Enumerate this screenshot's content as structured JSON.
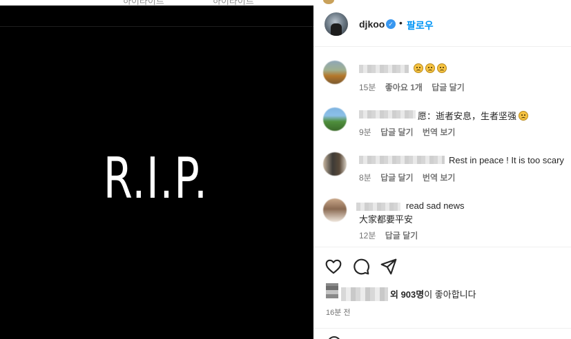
{
  "background": {
    "tab_labels": [
      "하이라이트",
      "하이라이트"
    ]
  },
  "post": {
    "image_text": "R.I.P."
  },
  "header": {
    "username": "djkoo",
    "verified_icon": "verified-badge-icon",
    "separator": "•",
    "follow_label": "팔로우"
  },
  "comments": [
    {
      "text": "",
      "meta": [
        "15분",
        "좋아요 1개",
        "답글 달기"
      ],
      "emojis": 3
    },
    {
      "text": "愿：逝者安息，生者坚强",
      "meta": [
        "9분",
        "답글 달기",
        "번역 보기"
      ],
      "emojis": 1
    },
    {
      "text": "Rest in peace ! It is too scary",
      "meta": [
        "8분",
        "답글 달기",
        "번역 보기"
      ],
      "emojis": 0
    },
    {
      "text": "read sad news",
      "text2": "大家都要平安",
      "meta": [
        "12분",
        "답글 달기"
      ],
      "emojis": 0
    }
  ],
  "actions": {
    "like_icon": "heart-icon",
    "comment_icon": "comment-icon",
    "share_icon": "send-icon"
  },
  "likes": {
    "count_text": "외 903명",
    "suffix": "이 좋아합니다"
  },
  "post_time": "16분 전",
  "colors": {
    "accent": "#0095f6",
    "text": "#262626",
    "meta": "#737373"
  }
}
